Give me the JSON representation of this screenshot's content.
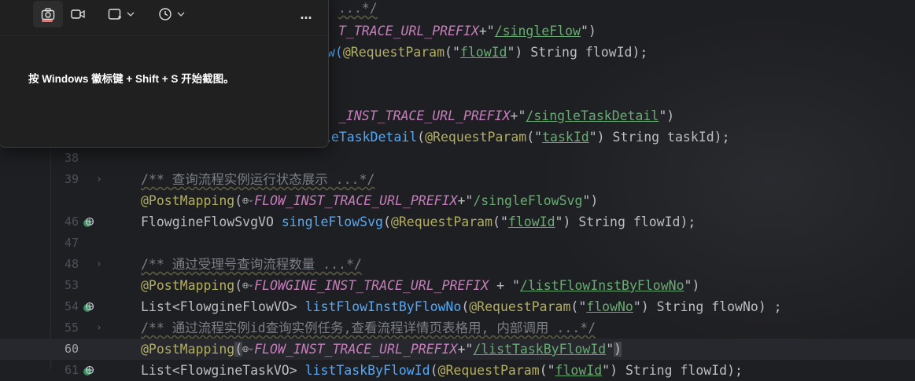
{
  "snipping_tool": {
    "hint": "按 Windows 徽标键 + Shift + S 开始截图。",
    "more_label": "..."
  },
  "editor": {
    "lines": [
      {
        "num": "",
        "parts": [
          {
            "t": "...*/",
            "c": "c-comment"
          }
        ]
      },
      {
        "num": "",
        "parts": [
          {
            "t": "T_TRACE_URL_PREFIX",
            "c": "c-const"
          },
          {
            "t": "+\"",
            "c": "c-plain"
          },
          {
            "t": "/singleFlow",
            "c": "c-strlink"
          },
          {
            "t": "\")",
            "c": "c-plain"
          }
        ]
      },
      {
        "num": "",
        "parts": [
          {
            "t": "w(",
            "c": "c-fn"
          },
          {
            "t": "@RequestParam",
            "c": "c-ann"
          },
          {
            "t": "(\"",
            "c": "c-plain"
          },
          {
            "t": "flowId",
            "c": "c-strlink"
          },
          {
            "t": "\") String flowId);",
            "c": "c-plain"
          }
        ]
      },
      {
        "num": "",
        "parts": []
      },
      {
        "num": "",
        "parts": [
          {
            "t": "_INST_TRACE_URL_PREFIX",
            "c": "c-const"
          },
          {
            "t": "+\"",
            "c": "c-plain"
          },
          {
            "t": "/singleTaskDetail",
            "c": "c-strlink"
          },
          {
            "t": "\")",
            "c": "c-plain"
          }
        ]
      },
      {
        "num": "",
        "parts": [
          {
            "t": "gleTaskDetail",
            "c": "c-fn"
          },
          {
            "t": "(",
            "c": "c-plain"
          },
          {
            "t": "@RequestParam",
            "c": "c-ann"
          },
          {
            "t": "(\"",
            "c": "c-plain"
          },
          {
            "t": "taskId",
            "c": "c-strlink"
          },
          {
            "t": "\") String taskId);",
            "c": "c-plain"
          }
        ]
      },
      {
        "num": "38",
        "parts": []
      },
      {
        "num": "39",
        "fold": true,
        "parts": [
          {
            "t": "/** 查询流程实例运行状态展示 ...*/",
            "c": "c-comment"
          }
        ]
      },
      {
        "num": "",
        "parts": [
          {
            "t": "@PostMapping",
            "c": "c-ann"
          },
          {
            "t": "(",
            "c": "c-plain"
          },
          {
            "globe": true
          },
          {
            "t": "FLOW_INST_TRACE_URL_PREFIX",
            "c": "c-const"
          },
          {
            "t": "+\"",
            "c": "c-plain"
          },
          {
            "t": "/singleFlowSvg",
            "c": "c-str"
          },
          {
            "t": "\")",
            "c": "c-plain"
          }
        ]
      },
      {
        "num": "46",
        "gicon": true,
        "parts": [
          {
            "t": "FlowgineFlowSvgVO ",
            "c": "c-plain"
          },
          {
            "t": "singleFlowSvg",
            "c": "c-fn"
          },
          {
            "t": "(",
            "c": "c-plain"
          },
          {
            "t": "@RequestParam",
            "c": "c-ann"
          },
          {
            "t": "(\"",
            "c": "c-plain"
          },
          {
            "t": "flowId",
            "c": "c-strlink"
          },
          {
            "t": "\") String flowId);",
            "c": "c-plain"
          }
        ]
      },
      {
        "num": "47",
        "parts": []
      },
      {
        "num": "48",
        "fold": true,
        "parts": [
          {
            "t": "/** 通过受理号查询流程数量 ...*/",
            "c": "c-comment"
          }
        ]
      },
      {
        "num": "53",
        "parts": [
          {
            "t": "@PostMapping",
            "c": "c-ann"
          },
          {
            "t": "(",
            "c": "c-plain"
          },
          {
            "globe": true
          },
          {
            "t": "FLOWGINE_INST_TRACE_URL_PREFIX",
            "c": "c-const"
          },
          {
            "t": " + \"",
            "c": "c-plain"
          },
          {
            "t": "/listFlowInstByFlowNo",
            "c": "c-strlink"
          },
          {
            "t": "\")",
            "c": "c-plain"
          }
        ]
      },
      {
        "num": "54",
        "gicon": true,
        "parts": [
          {
            "t": "List<FlowgineFlowVO> ",
            "c": "c-plain"
          },
          {
            "t": "listFlowInstByFlowNo",
            "c": "c-fn"
          },
          {
            "t": "(",
            "c": "c-plain"
          },
          {
            "t": "@RequestParam",
            "c": "c-ann"
          },
          {
            "t": "(\"",
            "c": "c-plain"
          },
          {
            "t": "flowNo",
            "c": "c-strlink"
          },
          {
            "t": "\") String flowNo) ;",
            "c": "c-plain"
          }
        ]
      },
      {
        "num": "55",
        "fold": true,
        "parts": [
          {
            "t": "/** 通过流程实例id查询实例任务,查看流程详情页表格用, 内部调用 ...*/",
            "c": "c-comment"
          }
        ]
      },
      {
        "num": "60",
        "current": true,
        "parts": [
          {
            "t": "@PostMapping",
            "c": "c-ann"
          },
          {
            "t": "(",
            "c": "c-brace"
          },
          {
            "globe": true
          },
          {
            "t": "FLOW_INST_TRACE_URL_PREFIX",
            "c": "c-const"
          },
          {
            "t": "+\"",
            "c": "c-plain"
          },
          {
            "t": "/listTaskByFlowId",
            "c": "c-strlink"
          },
          {
            "t": "\"",
            "c": "c-plain"
          },
          {
            "t": ")",
            "c": "c-brace"
          }
        ]
      },
      {
        "num": "61",
        "gicon": true,
        "parts": [
          {
            "t": "List<FlowgineTaskVO> ",
            "c": "c-plain"
          },
          {
            "t": "listTaskByFlowId",
            "c": "c-fn"
          },
          {
            "t": "(",
            "c": "c-plain"
          },
          {
            "t": "@RequestParam",
            "c": "c-ann"
          },
          {
            "t": "(\"",
            "c": "c-plain"
          },
          {
            "t": "flowId",
            "c": "c-strlink"
          },
          {
            "t": "\") String flowId);",
            "c": "c-plain"
          }
        ]
      }
    ]
  }
}
